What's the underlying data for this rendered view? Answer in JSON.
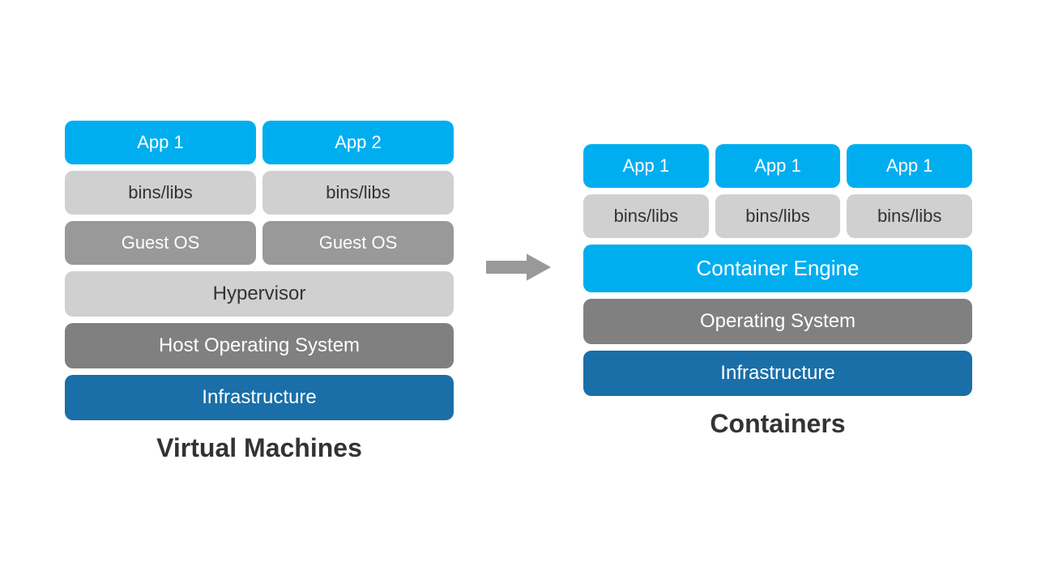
{
  "left": {
    "title": "Virtual Machines",
    "rows": {
      "app_row": [
        "App 1",
        "App 2"
      ],
      "bins_row": [
        "bins/libs",
        "bins/libs"
      ],
      "guestos_row": [
        "Guest OS",
        "Guest OS"
      ],
      "hypervisor": "Hypervisor",
      "host_os": "Host Operating System",
      "infrastructure": "Infrastructure"
    }
  },
  "right": {
    "title": "Containers",
    "rows": {
      "app_row": [
        "App 1",
        "App 1",
        "App 1"
      ],
      "bins_row": [
        "bins/libs",
        "bins/libs",
        "bins/libs"
      ],
      "container_engine": "Container Engine",
      "operating_system": "Operating System",
      "infrastructure": "Infrastructure"
    }
  },
  "arrow_label": "→"
}
